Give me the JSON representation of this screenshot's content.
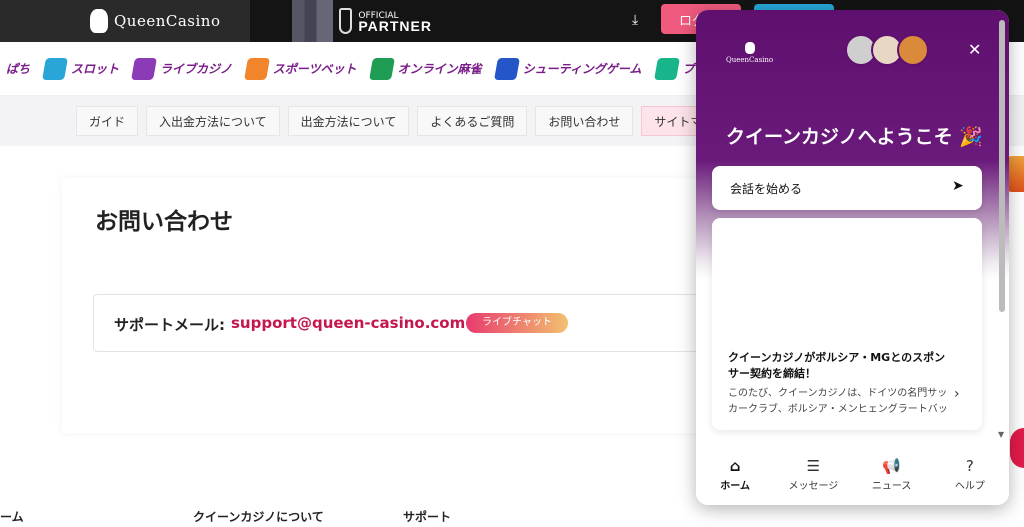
{
  "header": {
    "brand": "QueenCasino",
    "partner_small": "OFFICIAL",
    "partner_big": "PARTNER",
    "login_label": "ログ",
    "download_icon": "download-icon"
  },
  "categories": [
    {
      "label": "ぱち",
      "color": "#ffffff"
    },
    {
      "label": "スロット",
      "color": "#2aa5d8"
    },
    {
      "label": "ライブカジノ",
      "color": "#8a3bb5"
    },
    {
      "label": "スポーツベット",
      "color": "#f0852b"
    },
    {
      "label": "オンライン麻雀",
      "color": "#1f9d55"
    },
    {
      "label": "シューティングゲーム",
      "color": "#2556c9"
    },
    {
      "label": "プロモーション",
      "color": "#18b58a"
    },
    {
      "label": "",
      "color": "#d9a61a"
    }
  ],
  "subnav": [
    "ガイド",
    "入出金方法について",
    "出金方法について",
    "よくあるご質問",
    "お問い合わせ",
    "サイトマッ"
  ],
  "main": {
    "title": "お問い合わせ",
    "support_label": "サポートメール:",
    "support_email": "support@queen-casino.com",
    "chat_badge": "ライブチャット"
  },
  "footer": [
    "ーム",
    "クイーンカジノについて",
    "サポート"
  ],
  "widget": {
    "logo": "QueenCasino",
    "close_icon": "close-icon",
    "welcome": "クイーンカジノへようこそ 🎉",
    "start_label": "会話を始める",
    "news_title": "クイーンカジノがボルシア・MGとのスポンサー契約を締結！",
    "news_body": "このたび、クイーンカジノは、ドイツの名門サッカークラブ、ボルシア・メンヒェングラートバッハとのスポン...",
    "tabs": [
      {
        "label": "ホーム",
        "icon": "home-icon",
        "glyph": "⌂"
      },
      {
        "label": "メッセージ",
        "icon": "message-icon",
        "glyph": "☰"
      },
      {
        "label": "ニュース",
        "icon": "megaphone-icon",
        "glyph": "📢"
      },
      {
        "label": "ヘルプ",
        "icon": "help-icon",
        "glyph": "?"
      }
    ]
  }
}
